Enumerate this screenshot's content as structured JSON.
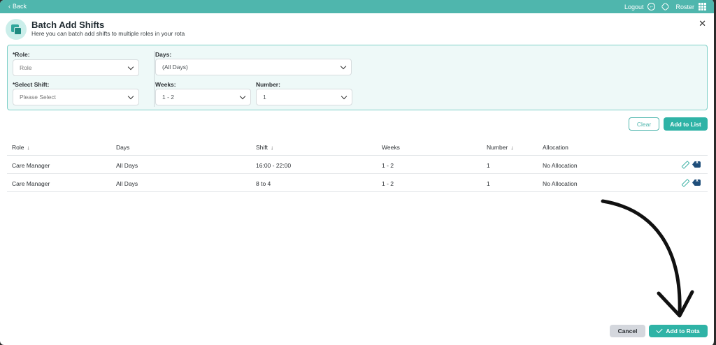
{
  "topbar": {
    "back_label": "Back",
    "logout_label": "Logout",
    "roster_label": "Roster"
  },
  "header": {
    "title": "Batch Add Shifts",
    "subtitle": "Here you can batch add shifts to multiple roles in your rota"
  },
  "form": {
    "role": {
      "label": "*Role:",
      "value": "Role"
    },
    "days": {
      "label": "Days:",
      "value": "(All Days)"
    },
    "shift": {
      "label": "*Select Shift:",
      "value": "Please Select"
    },
    "weeks": {
      "label": "Weeks:",
      "value": "1 - 2"
    },
    "number": {
      "label": "Number:",
      "value": "1"
    }
  },
  "actions": {
    "clear_label": "Clear",
    "add_to_list_label": "Add to List"
  },
  "table": {
    "columns": [
      "Role",
      "Days",
      "Shift",
      "Weeks",
      "Number",
      "Allocation"
    ],
    "rows": [
      [
        "Care Manager",
        "All Days",
        "16:00 - 22:00",
        "1 - 2",
        "1",
        "No Allocation"
      ],
      [
        "Care Manager",
        "All Days",
        "8 to 4",
        "1 - 2",
        "1",
        "No Allocation"
      ]
    ]
  },
  "footer": {
    "cancel_label": "Cancel",
    "add_to_rota_label": "Add to Rota"
  },
  "colors": {
    "accent": "#2fb3a6",
    "topbar": "#4fb6ad",
    "panel_bg": "#eef9f8"
  }
}
